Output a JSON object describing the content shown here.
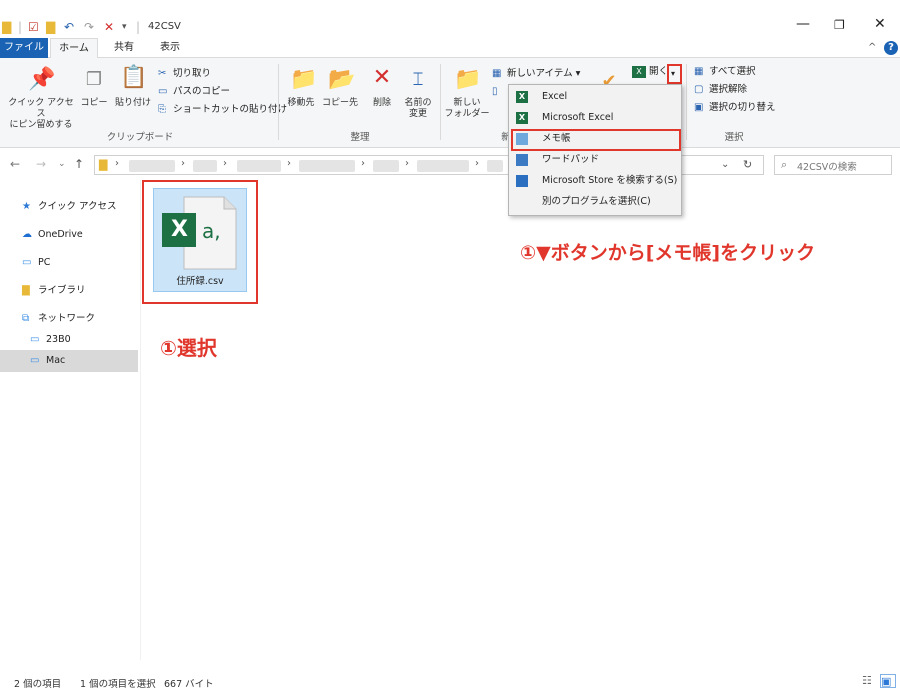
{
  "window": {
    "title": "42CSV",
    "controls": {
      "minimize": "—",
      "maximize": "❐",
      "close": "✕"
    }
  },
  "tabs": {
    "file": "ファイル",
    "home": "ホーム",
    "share": "共有",
    "view": "表示"
  },
  "ribbon": {
    "clipboard": {
      "pin_label": "クイック アクセス\nにピン留めする",
      "copy_label": "コピー",
      "paste_label": "貼り付け",
      "cut_label": "切り取り",
      "copy_path_label": "パスのコピー",
      "paste_shortcut_label": "ショートカットの貼り付け",
      "group_label": "クリップボード"
    },
    "organize": {
      "move_to_label": "移動先",
      "copy_to_label": "コピー先",
      "delete_label": "削除",
      "rename_label": "名前の\n変更",
      "group_label": "整理"
    },
    "new": {
      "new_folder_label": "新しい\nフォルダー",
      "new_item_label": "新しいアイテム",
      "group_label": "新"
    },
    "open": {
      "open_label": "開く"
    },
    "select": {
      "select_all_label": "すべて選択",
      "select_none_label": "選択解除",
      "invert_label": "選択の切り替え",
      "group_label": "選択"
    }
  },
  "search": {
    "placeholder": "42CSVの検索"
  },
  "sidebar": {
    "items": [
      {
        "label": "クイック アクセス",
        "icon": "star-icon"
      },
      {
        "label": "OneDrive",
        "icon": "cloud-icon"
      },
      {
        "label": "PC",
        "icon": "monitor-icon"
      },
      {
        "label": "ライブラリ",
        "icon": "library-icon"
      },
      {
        "label": "ネットワーク",
        "icon": "network-icon"
      },
      {
        "label": "23B0",
        "icon": "computer-icon"
      },
      {
        "label": "Mac",
        "icon": "computer-icon"
      }
    ]
  },
  "file": {
    "name": "住所録.csv",
    "icon_letters": "X",
    "icon_ext": "a,"
  },
  "dropdown": {
    "items": [
      {
        "label": "Excel",
        "icon_color": "#1d7044"
      },
      {
        "label": "Microsoft Excel",
        "icon_color": "#1d7044"
      },
      {
        "label": "メモ帳",
        "icon_color": "#6fa8dc"
      },
      {
        "label": "ワードパッド",
        "icon_color": "#3c7bc4"
      },
      {
        "label": "Microsoft Store を検索する(S)",
        "icon_color": "#2b6fc0"
      },
      {
        "label": "別のプログラムを選択(C)",
        "icon_color": ""
      }
    ]
  },
  "annotations": {
    "step_menu": "①▼ボタンから[メモ帳]をクリック",
    "step_select": "①選択"
  },
  "status": {
    "item_count": "2 個の項目",
    "selected": "1 個の項目を選択",
    "size": "667 バイト"
  },
  "colors": {
    "accent": "#1a62b3",
    "highlight_red": "#e0362c",
    "excel_green": "#1d7044"
  }
}
